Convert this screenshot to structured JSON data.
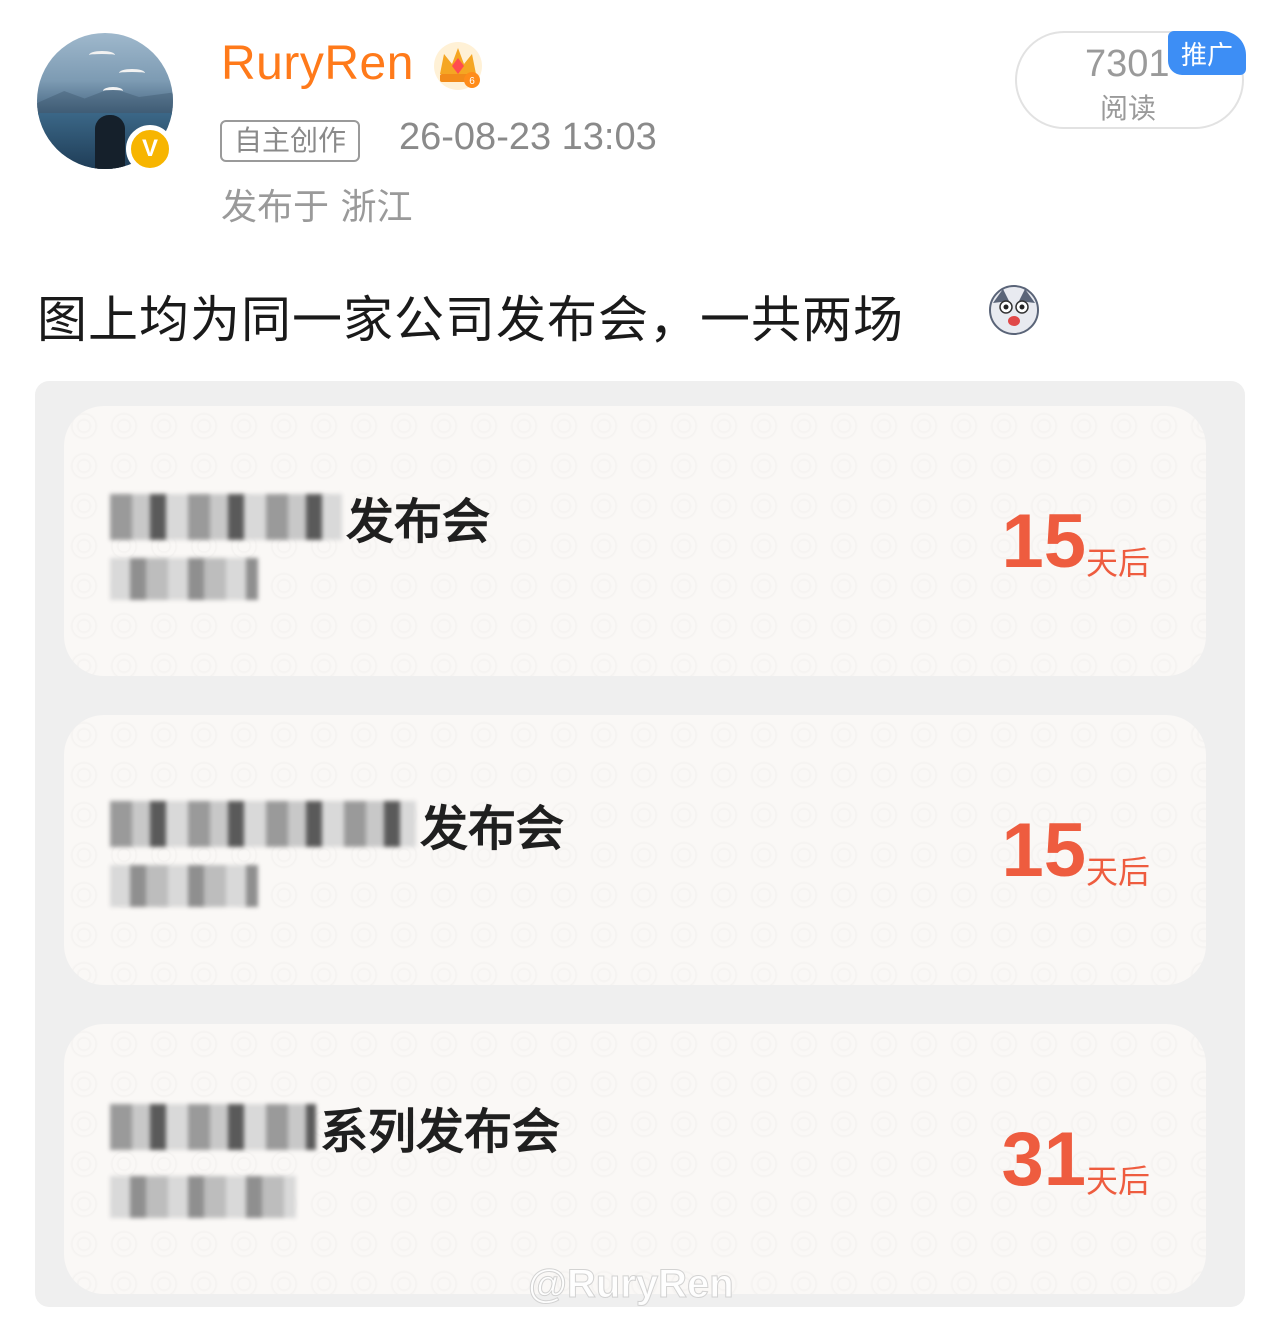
{
  "user": {
    "name": "RuryRen",
    "verified_mark": "V",
    "tag": "自主创作",
    "time": "26-08-23 13:03",
    "location": "发布于 浙江"
  },
  "stats": {
    "reads": "7301",
    "reads_label": "阅读",
    "promo": "推广"
  },
  "post": {
    "text": "图上均为同一家公司发布会，一共两场"
  },
  "cards": [
    {
      "title_suffix": "发布会",
      "count": "15",
      "unit": "天后"
    },
    {
      "title_suffix": "发布会",
      "count": "15",
      "unit": "天后"
    },
    {
      "title_suffix": "系列发布会",
      "count": "31",
      "unit": "天后"
    }
  ],
  "watermark": "@RuryRen",
  "colors": {
    "username": "#ff7a1a",
    "count": "#ee5c3f",
    "promo": "#3d8ef5",
    "verified": "#f7b500"
  },
  "icons": [
    "crown-icon",
    "verified-icon",
    "emoji-icon"
  ]
}
